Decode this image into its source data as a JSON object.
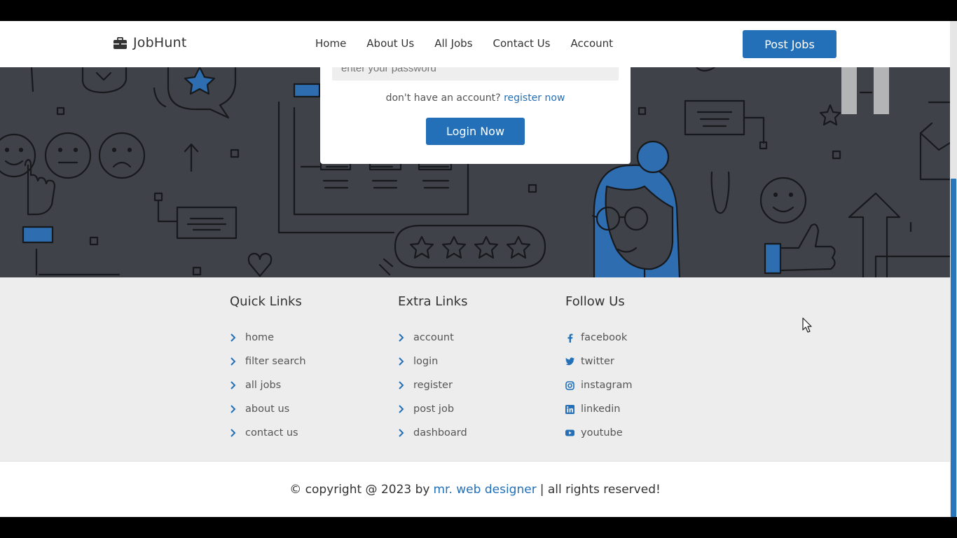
{
  "header": {
    "logo_text": "JobHunt",
    "nav": [
      "Home",
      "About Us",
      "All Jobs",
      "Contact Us",
      "Account"
    ],
    "post_jobs_label": "Post Jobs"
  },
  "login": {
    "password_placeholder": "enter your password",
    "register_prompt": "don't have an account?",
    "register_link": "register now",
    "login_button": "Login Now"
  },
  "footer": {
    "quick_links": {
      "title": "Quick Links",
      "items": [
        "home",
        "filter search",
        "all jobs",
        "about us",
        "contact us"
      ]
    },
    "extra_links": {
      "title": "Extra Links",
      "items": [
        "account",
        "login",
        "register",
        "post job",
        "dashboard"
      ]
    },
    "follow_us": {
      "title": "Follow Us",
      "items": [
        {
          "label": "facebook",
          "icon": "facebook-icon"
        },
        {
          "label": "twitter",
          "icon": "twitter-icon"
        },
        {
          "label": "instagram",
          "icon": "instagram-icon"
        },
        {
          "label": "linkedin",
          "icon": "linkedin-icon"
        },
        {
          "label": "youtube",
          "icon": "youtube-icon"
        }
      ]
    }
  },
  "copyright": {
    "prefix": "© copyright @ 2023 by",
    "author_link": "mr. web designer",
    "suffix": "| all rights reserved!"
  },
  "colors": {
    "accent": "#2370b8",
    "hero_bg": "#3f4249",
    "footer_bg": "#ededed"
  }
}
